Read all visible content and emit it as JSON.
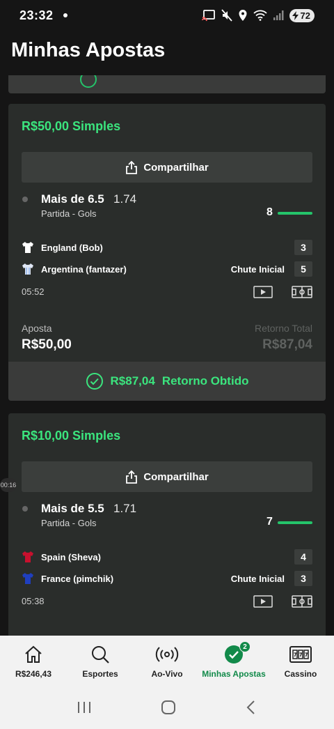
{
  "status_bar": {
    "time": "23:32",
    "battery": "72"
  },
  "page": {
    "title": "Minhas Apostas"
  },
  "bets": [
    {
      "title": "R$50,00 Simples",
      "share_label": "Compartilhar",
      "selection": {
        "name": "Mais de 6.5",
        "odds": "1.74",
        "market": "Partida - Gols",
        "goal_count": "8"
      },
      "teams": [
        {
          "name": "England (Bob)",
          "score": "3",
          "status": "",
          "shirt_color": "#ffffff"
        },
        {
          "name": "Argentina (fantazer)",
          "score": "5",
          "status": "Chute Inicial",
          "shirt_color": "#dfe7f5"
        }
      ],
      "match_time": "05:52",
      "stake_label": "Aposta",
      "stake_value": "R$50,00",
      "return_label": "Retorno Total",
      "return_value": "R$87,04",
      "result_amount": "R$87,04",
      "result_label": "Retorno Obtido"
    },
    {
      "title": "R$10,00 Simples",
      "share_label": "Compartilhar",
      "selection": {
        "name": "Mais de 5.5",
        "odds": "1.71",
        "market": "Partida - Gols",
        "goal_count": "7"
      },
      "teams": [
        {
          "name": "Spain (Sheva)",
          "score": "4",
          "status": "",
          "shirt_color": "#c8102e"
        },
        {
          "name": "France (pimchik)",
          "score": "3",
          "status": "Chute Inicial",
          "shirt_color": "#1f3fbf"
        }
      ],
      "match_time": "05:38"
    }
  ],
  "timer_bubble": "00:16",
  "bottom_nav": [
    {
      "label": "R$246,43",
      "icon": "home-icon"
    },
    {
      "label": "Esportes",
      "icon": "search-icon"
    },
    {
      "label": "Ao-Vivo",
      "icon": "live-broadcast-icon"
    },
    {
      "label": "Minhas Apostas",
      "icon": "check-circle-icon",
      "badge": "2",
      "active": true
    },
    {
      "label": "Cassino",
      "icon": "slot-machine-icon"
    }
  ],
  "colors": {
    "accent": "#3be57e",
    "nav_active": "#128a4a",
    "card": "#2a2d2b",
    "background": "#151515"
  }
}
